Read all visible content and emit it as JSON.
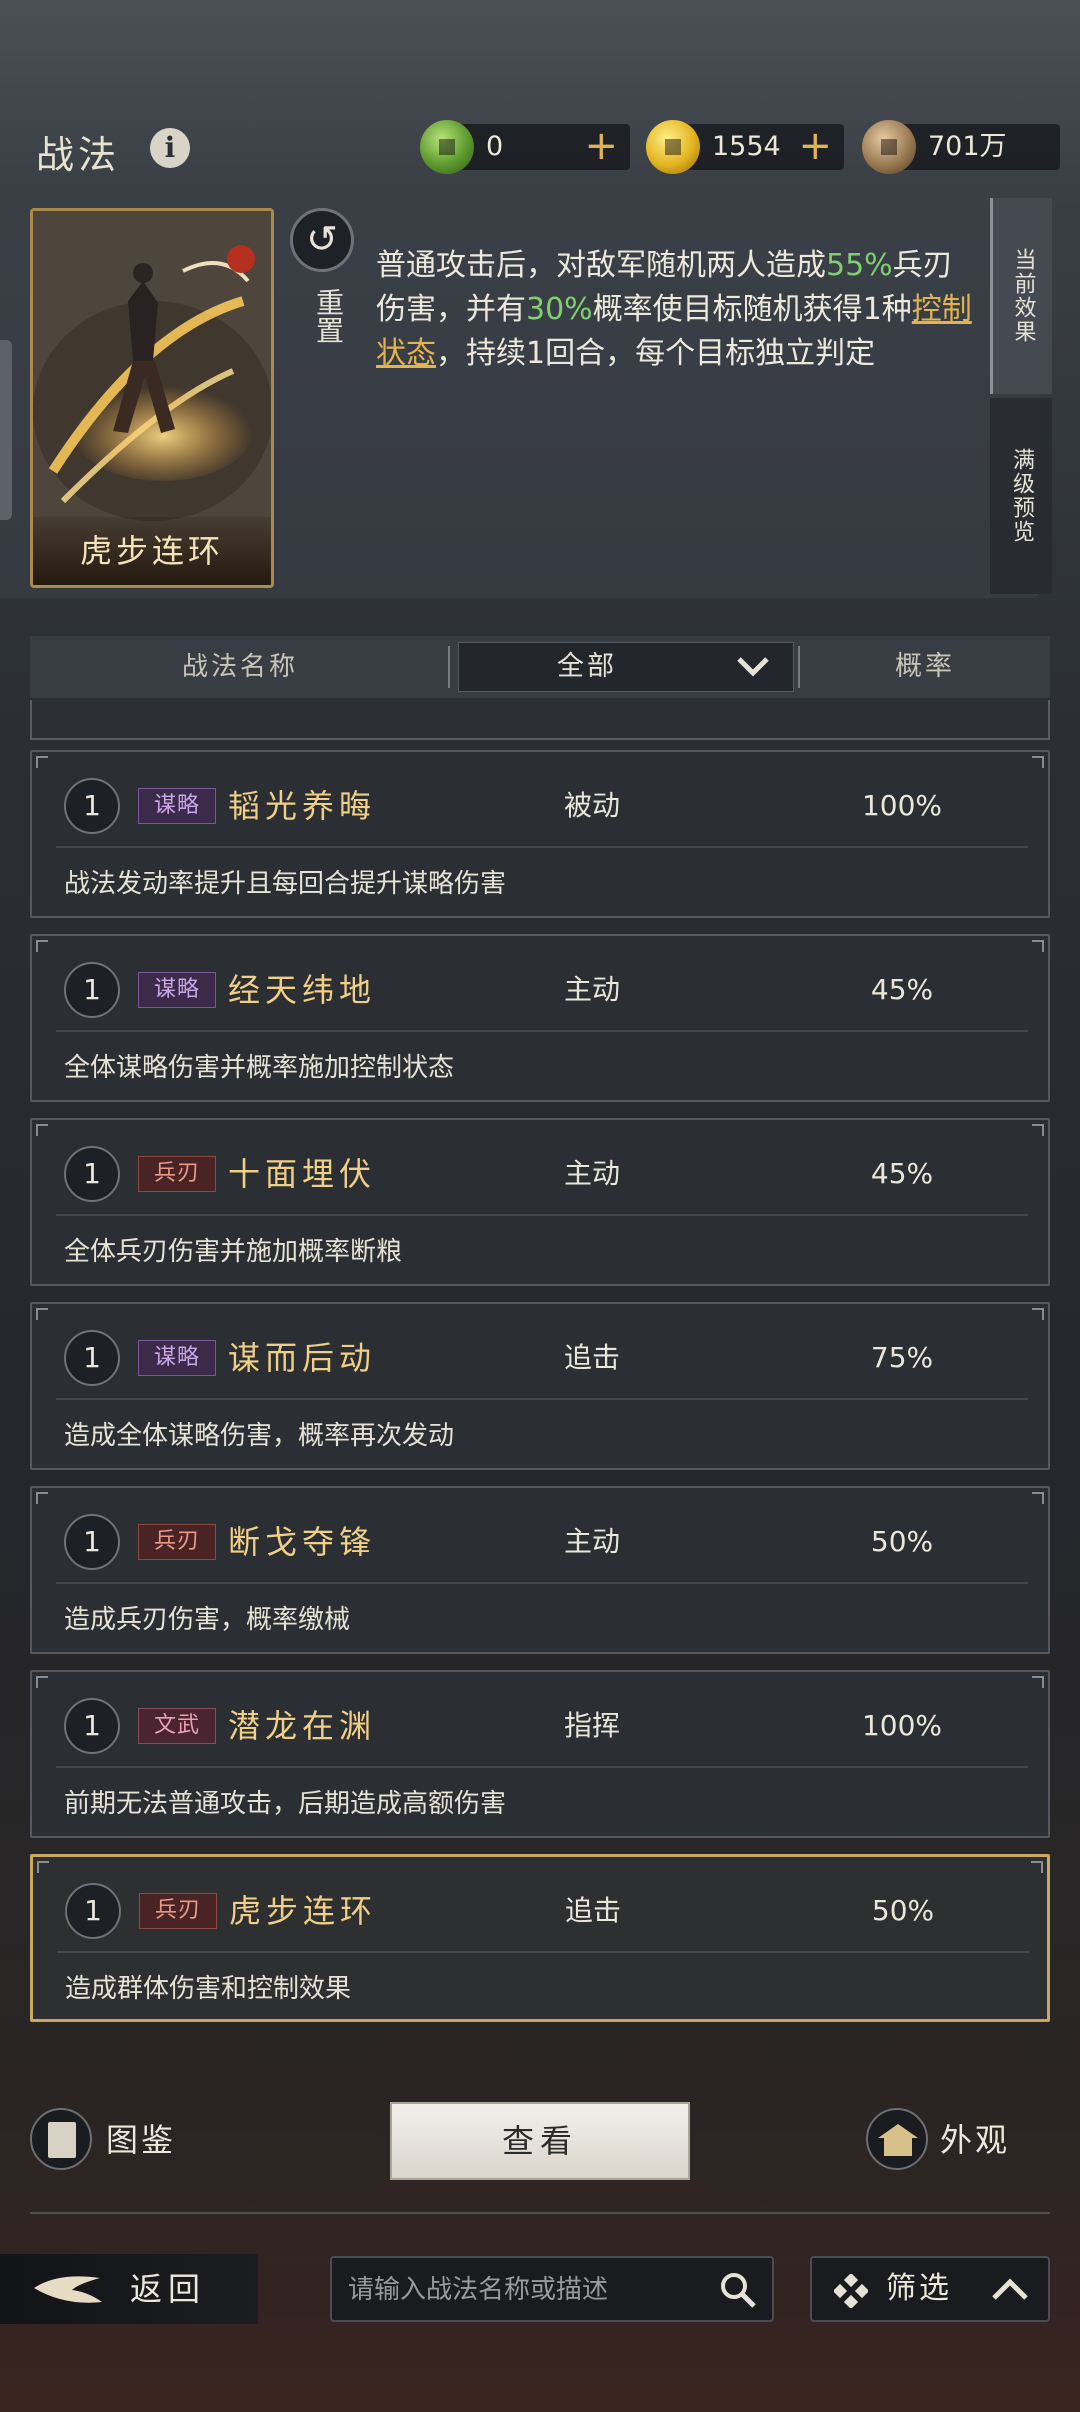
{
  "header": {
    "title": "战法",
    "currencies": [
      {
        "icon": "jade-coin-icon",
        "amount": "0"
      },
      {
        "icon": "gold-coin-icon",
        "amount": "1554"
      },
      {
        "icon": "copper-coin-icon",
        "amount": "701万"
      }
    ]
  },
  "detail": {
    "card_name": "虎步连环",
    "reset_label": "重置",
    "desc_parts": {
      "p1": "普通攻击后，对敌军随机两人造成",
      "pct1": "55%",
      "p2": "兵刃伤害，并有",
      "pct2": "30%",
      "p3": "概率使目标随机获得1种",
      "link": "控制状态",
      "p4": "，持续1回合，每个目标独立判定"
    },
    "tabs": {
      "current": "当前效果",
      "max": "满级预览"
    }
  },
  "filter_header": {
    "name_col": "战法名称",
    "dropdown": "全部",
    "rate_col": "概率"
  },
  "skills": [
    {
      "level": "1",
      "tag": "谋略",
      "name": "韬光养晦",
      "type": "被动",
      "rate": "100%",
      "desc": "战法发动率提升且每回合提升谋略伤害"
    },
    {
      "level": "1",
      "tag": "谋略",
      "name": "经天纬地",
      "type": "主动",
      "rate": "45%",
      "desc": "全体谋略伤害并概率施加控制状态"
    },
    {
      "level": "1",
      "tag": "兵刃",
      "name": "十面埋伏",
      "type": "主动",
      "rate": "45%",
      "desc": "全体兵刃伤害并施加概率断粮"
    },
    {
      "level": "1",
      "tag": "谋略",
      "name": "谋而后动",
      "type": "追击",
      "rate": "75%",
      "desc": "造成全体谋略伤害，概率再次发动"
    },
    {
      "level": "1",
      "tag": "兵刃",
      "name": "断戈夺锋",
      "type": "主动",
      "rate": "50%",
      "desc": "造成兵刃伤害，概率缴械"
    },
    {
      "level": "1",
      "tag": "文武",
      "name": "潜龙在渊",
      "type": "指挥",
      "rate": "100%",
      "desc": "前期无法普通攻击，后期造成高额伤害"
    },
    {
      "level": "1",
      "tag": "兵刃",
      "name": "虎步连环",
      "type": "追击",
      "rate": "50%",
      "desc": "造成群体伤害和控制效果"
    }
  ],
  "actions": {
    "tujian": "图鉴",
    "view": "查看",
    "waiguan": "外观"
  },
  "bottom_bar": {
    "back": "返回",
    "search_placeholder": "请输入战法名称或描述",
    "filter": "筛选"
  },
  "colors": {
    "accent_gold": "#e2b450",
    "highlight_green": "#7fd070",
    "skill_name": "#f0cf86",
    "selected_border": "#c9a860"
  }
}
